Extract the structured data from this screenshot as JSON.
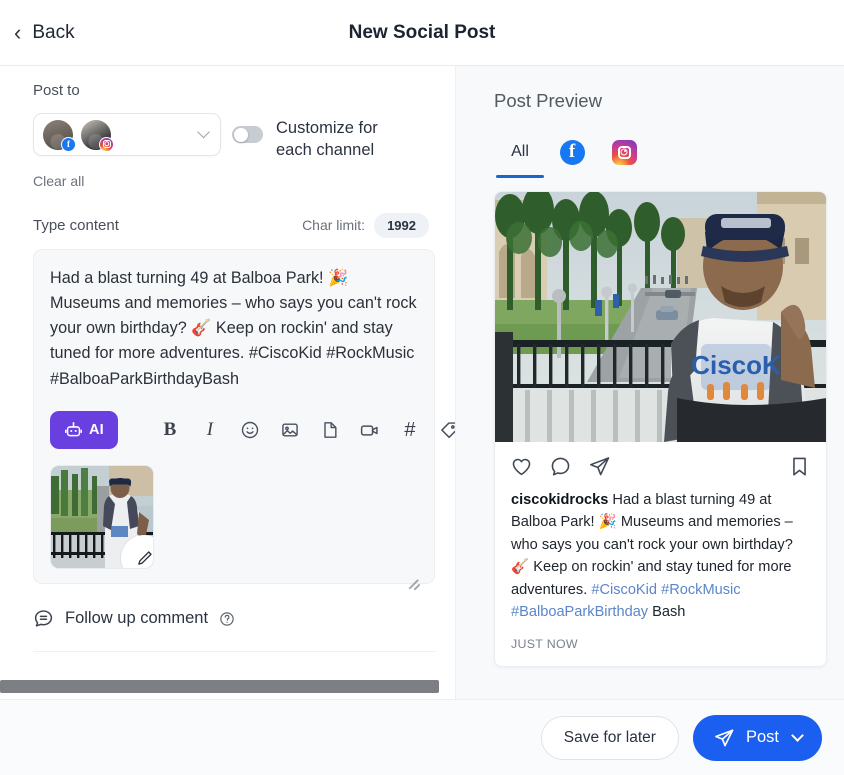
{
  "header": {
    "back_label": "Back",
    "title": "New Social Post",
    "back_icon": "chevron-left-icon"
  },
  "compose": {
    "post_to_label": "Post to",
    "channel_accounts": [
      {
        "platform": "facebook",
        "badge_glyph": "f"
      },
      {
        "platform": "instagram",
        "badge_glyph": "ig"
      }
    ],
    "customize_toggle_label": "Customize for each channel",
    "customize_toggle_on": false,
    "clear_all_label": "Clear all",
    "type_content_label": "Type content",
    "char_limit_label": "Char limit:",
    "char_limit_value": "1992",
    "content_text": "Had a blast turning 49 at Balboa Park! 🎉 Museums and memories – who says you can't rock your own birthday? 🎸 Keep on rockin' and stay tuned for more adventures. #CiscoKid #RockMusic #BalboaParkBirthdayBash",
    "toolbar": {
      "ai_label": "AI",
      "ai_icon": "robot-icon",
      "ai_color": "#6a3fe0",
      "items": [
        {
          "name": "bold-icon",
          "glyph": "B"
        },
        {
          "name": "italic-icon",
          "glyph": "I"
        },
        {
          "name": "emoji-icon",
          "glyph": "☺"
        },
        {
          "name": "image-icon",
          "glyph": "image"
        },
        {
          "name": "document-icon",
          "glyph": "doc"
        },
        {
          "name": "video-icon",
          "glyph": "video"
        },
        {
          "name": "hashtag-icon",
          "glyph": "#"
        },
        {
          "name": "tag-icon",
          "glyph": "tag"
        }
      ]
    },
    "attachment_edit_icon": "pencil-icon",
    "follow_up_label": "Follow up comment",
    "follow_up_help_icon": "question-circle-icon"
  },
  "preview": {
    "title": "Post Preview",
    "tabs": [
      {
        "label": "All",
        "type": "text",
        "active": true
      },
      {
        "label": "Facebook",
        "type": "facebook",
        "active": false
      },
      {
        "label": "Instagram",
        "type": "instagram",
        "active": false
      }
    ],
    "active_underline_color": "#1866d6",
    "card": {
      "actions": [
        {
          "name": "like-icon"
        },
        {
          "name": "comment-icon"
        },
        {
          "name": "share-icon"
        },
        {
          "name": "bookmark-icon"
        }
      ],
      "username": "ciscokidrocks",
      "caption_body": "  Had a blast turning 49 at Balboa Park! 🎉 Museums and memories – who says you can't rock your own birthday? 🎸 Keep on rockin' and stay tuned for more adventures. ",
      "hashtags": "#CiscoKid #RockMusic #BalboaParkBirthday",
      "caption_tail": " Bash",
      "timestamp": "JUST NOW",
      "hashtag_color": "#5b86c9"
    }
  },
  "footer": {
    "save_label": "Save for later",
    "post_label": "Post",
    "post_icon": "send-icon",
    "post_chevron_icon": "chevron-down-icon",
    "primary_color": "#1a5ff0"
  }
}
